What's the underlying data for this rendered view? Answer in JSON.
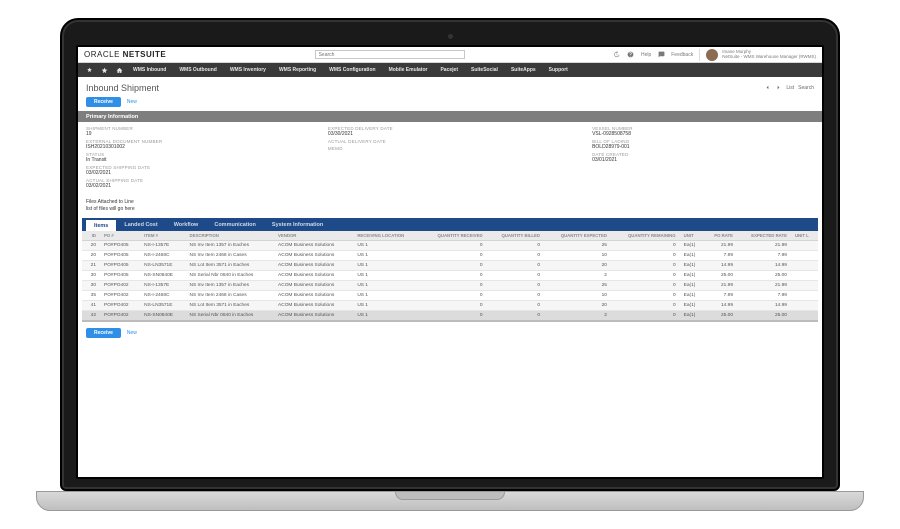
{
  "brand": {
    "light": "ORACLE",
    "bold": "NETSUITE"
  },
  "search": {
    "placeholder": "Search"
  },
  "top_right": {
    "help": "Help",
    "feedback": "Feedback",
    "user_name": "Imane Murphy",
    "user_role": "NetSuite - WMS Warehouse Manager (RWMS)"
  },
  "nav": {
    "star": "star-icon",
    "home": "home-icon",
    "items": [
      "WMS Inbound",
      "WMS Outbound",
      "WMS Inventory",
      "WMS Reporting",
      "WMS Configuration",
      "Mobile Emulator",
      "Pacejet",
      "SuiteSocial",
      "SuiteApps",
      "Support"
    ]
  },
  "page_title": "Inbound Shipment",
  "title_actions": {
    "list": "List",
    "search": "Search"
  },
  "actions": {
    "receive": "Receive",
    "new": "New"
  },
  "section_primary": "Primary Information",
  "primary": {
    "col1": [
      {
        "label": "SHIPMENT NUMBER",
        "value": "19"
      },
      {
        "label": "EXTERNAL DOCUMENT NUMBER",
        "value": "ISH20210301002"
      },
      {
        "label": "STATUS",
        "value": "In Transit"
      },
      {
        "label": "EXPECTED SHIPPING DATE",
        "value": "03/02/2021"
      },
      {
        "label": "ACTUAL SHIPPING DATE",
        "value": "03/02/2021"
      }
    ],
    "col2": [
      {
        "label": "EXPECTED DELIVERY DATE",
        "value": "03/30/2021"
      },
      {
        "label": "ACTUAL DELIVERY DATE",
        "value": ""
      },
      {
        "label": "MEMO",
        "value": ""
      }
    ],
    "col3": [
      {
        "label": "VESSEL NUMBER",
        "value": "VSL-0928508758"
      },
      {
        "label": "BILL OF LADING",
        "value": "BOLD28979-001"
      },
      {
        "label": "DATE CREATED",
        "value": "03/01/2021"
      }
    ]
  },
  "files_note_1": "Files Attached to Line",
  "files_note_2": "list of files will go here",
  "subtabs": [
    "Items",
    "Landed Cost",
    "Workflow",
    "Communication",
    "System Information"
  ],
  "table": {
    "headers": [
      "ID",
      "PO #",
      "ITEM #",
      "DESCRIPTION",
      "VENDOR",
      "RECEIVING LOCATION",
      "QUANTITY RECEIVED",
      "QUANTITY BILLED",
      "QUANTITY EXPECTED",
      "QUANTITY REMAINING",
      "UNIT",
      "PO RATE",
      "EXPECTED RATE",
      "UNIT L"
    ],
    "rows": [
      {
        "id": "20",
        "po": "PO#PO405",
        "item": "NS-I-1357E",
        "desc": "NS Inv Item 1357 in Eaches",
        "vendor": "ACOM Business Solutions",
        "loc": "US 1",
        "qr": "0",
        "qb": "0",
        "qe": "25",
        "qrm": "0",
        "unit": "Ea(1)",
        "porate": "21.99",
        "erate": "21.99"
      },
      {
        "id": "20",
        "po": "PO#PO405",
        "item": "NS-I-2468C",
        "desc": "NS Inv Item 2468 in Cases",
        "vendor": "ACOM Business Solutions",
        "loc": "US 1",
        "qr": "0",
        "qb": "0",
        "qe": "10",
        "qrm": "0",
        "unit": "Ea(1)",
        "porate": "7.99",
        "erate": "7.99"
      },
      {
        "id": "21",
        "po": "PO#PO405",
        "item": "NS-LN3571E",
        "desc": "NS Lot Item 3571 in Eaches",
        "vendor": "ACOM Business Solutions",
        "loc": "US 1",
        "qr": "0",
        "qb": "0",
        "qe": "20",
        "qrm": "0",
        "unit": "Ea(1)",
        "porate": "14.99",
        "erate": "14.99"
      },
      {
        "id": "30",
        "po": "PO#PO405",
        "item": "NS-SN0840E",
        "desc": "NS Serial Nbr 0840 in Eaches",
        "vendor": "ACOM Business Solutions",
        "loc": "US 1",
        "qr": "0",
        "qb": "0",
        "qe": "2",
        "qrm": "0",
        "unit": "Ea(1)",
        "porate": "25.00",
        "erate": "25.00"
      },
      {
        "id": "30",
        "po": "PO#PO402",
        "item": "NS-I-1357E",
        "desc": "NS Inv Item 1357 in Eaches",
        "vendor": "ACOM Business Solutions",
        "loc": "US 1",
        "qr": "0",
        "qb": "0",
        "qe": "25",
        "qrm": "0",
        "unit": "Ea(1)",
        "porate": "21.99",
        "erate": "21.99"
      },
      {
        "id": "35",
        "po": "PO#PO402",
        "item": "NS-I-2468C",
        "desc": "NS Inv Item 2468 in Cases",
        "vendor": "ACOM Business Solutions",
        "loc": "US 1",
        "qr": "0",
        "qb": "0",
        "qe": "10",
        "qrm": "0",
        "unit": "Ea(1)",
        "porate": "7.99",
        "erate": "7.99"
      },
      {
        "id": "41",
        "po": "PO#PO402",
        "item": "NS-LN3571E",
        "desc": "NS Lot Item 3571 in Eaches",
        "vendor": "ACOM Business Solutions",
        "loc": "US 1",
        "qr": "0",
        "qb": "0",
        "qe": "20",
        "qrm": "0",
        "unit": "Ea(1)",
        "porate": "14.99",
        "erate": "14.99"
      },
      {
        "id": "42",
        "po": "PO#PO402",
        "item": "NS-SN0840E",
        "desc": "NS Serial Nbr 0840 in Eaches",
        "vendor": "ACOM Business Solutions",
        "loc": "US 1",
        "qr": "0",
        "qb": "0",
        "qe": "2",
        "qrm": "0",
        "unit": "Ea(1)",
        "porate": "25.00",
        "erate": "25.00"
      }
    ]
  }
}
